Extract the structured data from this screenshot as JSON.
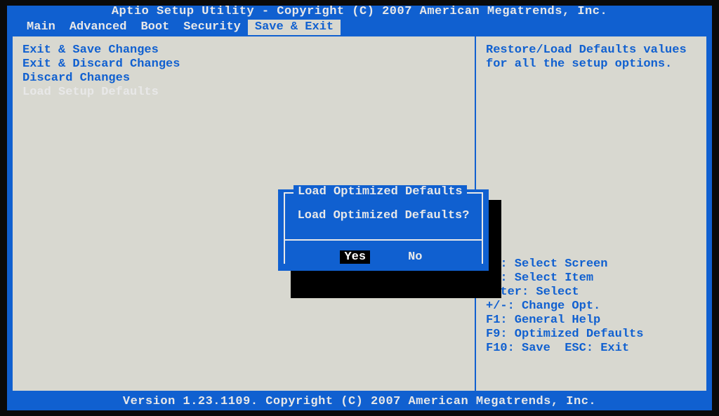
{
  "header": {
    "title": "Aptio Setup Utility - Copyright (C) 2007 American Megatrends, Inc."
  },
  "menu": {
    "items": [
      {
        "label": "Main",
        "active": false
      },
      {
        "label": "Advanced",
        "active": false
      },
      {
        "label": "Boot",
        "active": false
      },
      {
        "label": "Security",
        "active": false
      },
      {
        "label": "Save & Exit",
        "active": true
      }
    ]
  },
  "options": [
    {
      "label": "Exit & Save Changes",
      "selected": false
    },
    {
      "label": "Exit & Discard Changes",
      "selected": false
    },
    {
      "label": "Discard Changes",
      "selected": false
    },
    {
      "label": "Load Setup Defaults",
      "selected": true
    }
  ],
  "help": {
    "line1": "Restore/Load Defaults values",
    "line2": "for all the setup options."
  },
  "hints": {
    "k0": "→←: Select Screen",
    "k1": "↑↓: Select Item",
    "k2": "Enter: Select",
    "k3": "+/-: Change Opt.",
    "k4": "F1: General Help",
    "k5": "F9: Optimized Defaults",
    "k6": "F10: Save  ESC: Exit"
  },
  "dialog": {
    "title": "Load Optimized Defaults",
    "message": "Load Optimized Defaults?",
    "yes": "Yes",
    "no": "No"
  },
  "footer": {
    "text": "Version 1.23.1109. Copyright (C) 2007 American Megatrends, Inc."
  }
}
